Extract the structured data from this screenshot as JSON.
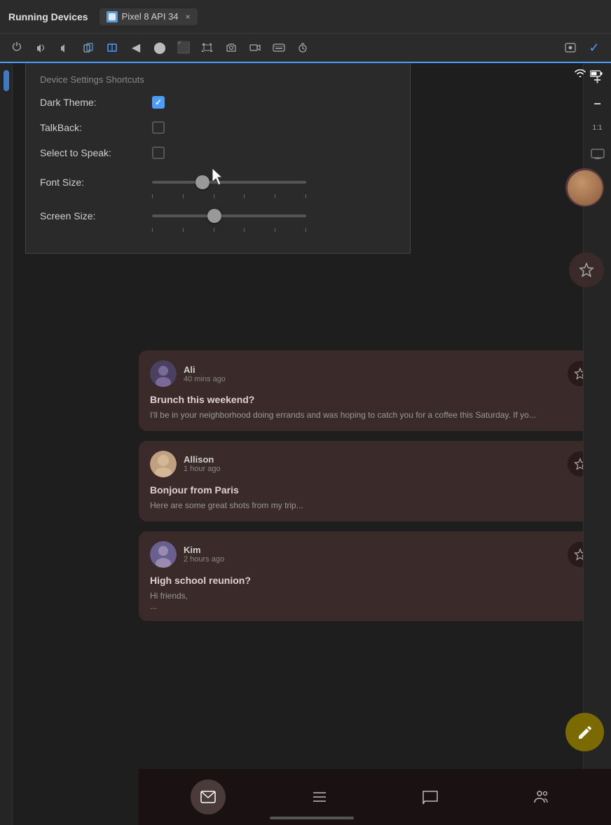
{
  "titleBar": {
    "appName": "Running Devices",
    "tab": {
      "label": "Pixel 8 API 34",
      "closeBtn": "×"
    }
  },
  "toolbar": {
    "buttons": [
      "⏻",
      "🔊",
      "🔇",
      "📱",
      "📲",
      "◀",
      "⬤",
      "⬛",
      "⌨",
      "📷",
      "📹",
      "⌨",
      "⏱"
    ],
    "rightButtons": [
      "⊟",
      "✓"
    ]
  },
  "deviceSettings": {
    "title": "Device Settings Shortcuts",
    "rows": [
      {
        "label": "Dark Theme:",
        "type": "checkbox",
        "checked": true
      },
      {
        "label": "TalkBack:",
        "type": "checkbox",
        "checked": false
      },
      {
        "label": "Select to Speak:",
        "type": "checkbox",
        "checked": false
      },
      {
        "label": "Font Size:",
        "type": "slider",
        "value": 30
      },
      {
        "label": "Screen Size:",
        "type": "slider",
        "value": 40
      }
    ]
  },
  "statusBar": {
    "wifi": "📶",
    "battery": "🔋"
  },
  "emailCards": [
    {
      "sender": "Ali",
      "time": "40 mins ago",
      "subject": "Brunch this weekend?",
      "preview": "I'll be in your neighborhood doing errands and was hoping to catch you for a coffee this Saturday. If yo...",
      "avatarColor": "#4a4060"
    },
    {
      "sender": "Allison",
      "time": "1 hour ago",
      "subject": "Bonjour from Paris",
      "preview": "Here are some great shots from my trip...",
      "avatarColor": "#c0a080"
    },
    {
      "sender": "Kim",
      "time": "2 hours ago",
      "subject": "High school reunion?",
      "preview": "Hi friends,",
      "previewExtra": "...",
      "avatarColor": "#6a6090"
    }
  ],
  "bottomNav": {
    "tabs": [
      "email",
      "list",
      "chat",
      "people"
    ]
  },
  "rightPanel": {
    "buttons": [
      "+",
      "−",
      "1:1"
    ]
  }
}
